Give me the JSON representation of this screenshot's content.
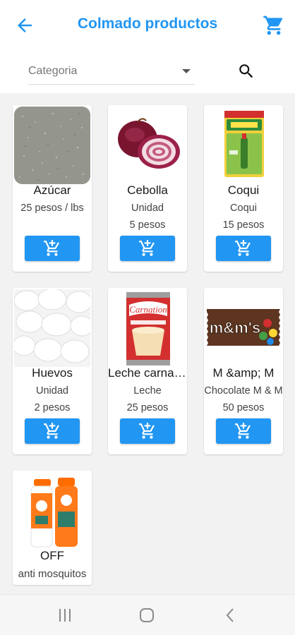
{
  "header": {
    "title": "Colmado productos",
    "back_icon": "arrow-back-icon",
    "cart_icon": "shopping-cart-icon",
    "accent_color": "#2196f3"
  },
  "filter": {
    "category_placeholder": "Categoria",
    "search_icon": "search-icon"
  },
  "products": [
    {
      "name": "Azúcar",
      "subtitle": "",
      "price": "25 pesos / lbs",
      "image": "sugar-image"
    },
    {
      "name": "Cebolla",
      "subtitle": "Unidad",
      "price": "5 pesos",
      "image": "onion-image"
    },
    {
      "name": "Coqui",
      "subtitle": "Coqui",
      "price": "15 pesos",
      "image": "coqui-glue-image"
    },
    {
      "name": "Huevos",
      "subtitle": "Unidad",
      "price": "2 pesos",
      "image": "eggs-image"
    },
    {
      "name": "Leche carnation",
      "subtitle": "Leche",
      "price": "25 pesos",
      "image": "carnation-milk-can-image"
    },
    {
      "name": "M &amp; M",
      "subtitle": "Chocolate M & M",
      "price": "50 pesos",
      "image": "mm-candy-bag-image"
    },
    {
      "name": "OFF",
      "subtitle": "anti mosquitos",
      "price": "",
      "image": "off-spray-image"
    }
  ],
  "add_to_cart_icon": "add-shopping-cart-icon",
  "system_nav": {
    "recents_icon": "recents-icon",
    "home_icon": "home-icon",
    "back_icon": "nav-back-icon"
  }
}
